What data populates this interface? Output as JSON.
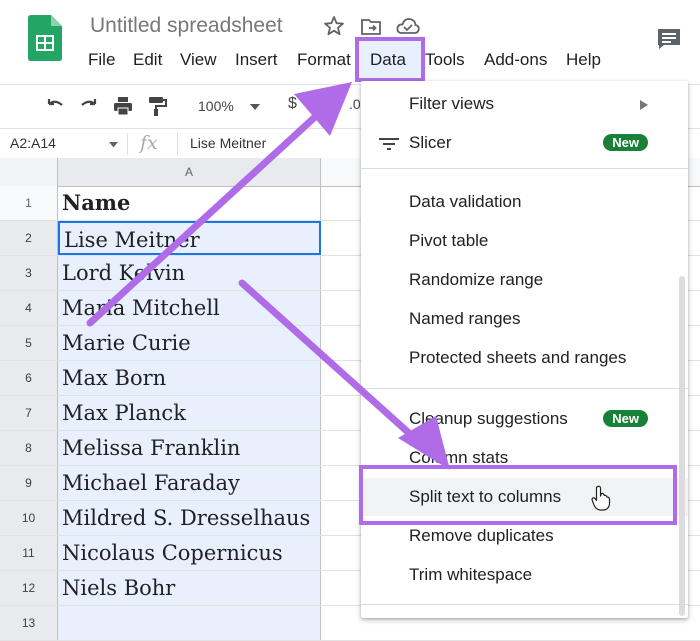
{
  "app": {
    "title": "Untitled spreadsheet",
    "logo_icon": "sheets-logo-icon"
  },
  "menu": {
    "file": "File",
    "edit": "Edit",
    "view": "View",
    "insert": "Insert",
    "format": "Format",
    "data": "Data",
    "tools": "Tools",
    "addons": "Add-ons",
    "help": "Help"
  },
  "toolbar": {
    "zoom": "100%",
    "currency": "$",
    "decimal": ".0"
  },
  "formula_bar": {
    "name_box": "A2:A14",
    "fx": "fx",
    "value": "Lise Meitner"
  },
  "grid": {
    "column_a": "A",
    "rows": [
      {
        "num": "1",
        "value": "Name"
      },
      {
        "num": "2",
        "value": "Lise Meitner"
      },
      {
        "num": "3",
        "value": "Lord Kelvin"
      },
      {
        "num": "4",
        "value": "Maria Mitchell"
      },
      {
        "num": "5",
        "value": "Marie Curie"
      },
      {
        "num": "6",
        "value": "Max Born"
      },
      {
        "num": "7",
        "value": "Max Planck"
      },
      {
        "num": "8",
        "value": "Melissa Franklin"
      },
      {
        "num": "9",
        "value": "Michael Faraday"
      },
      {
        "num": "10",
        "value": "Mildred S. Dresselhaus"
      },
      {
        "num": "11",
        "value": "Nicolaus Copernicus"
      },
      {
        "num": "12",
        "value": "Niels Bohr"
      },
      {
        "num": "13",
        "value": ""
      }
    ]
  },
  "data_menu": {
    "filter_views": "Filter views",
    "slicer": "Slicer",
    "new_badge_1": "New",
    "data_validation": "Data validation",
    "pivot_table": "Pivot table",
    "randomize_range": "Randomize range",
    "named_ranges": "Named ranges",
    "protected_sheets": "Protected sheets and ranges",
    "cleanup_suggestions": "Cleanup suggestions",
    "new_badge_2": "New",
    "column_stats": "Column stats",
    "split_text": "Split text to columns",
    "remove_duplicates": "Remove duplicates",
    "trim_whitespace": "Trim whitespace"
  },
  "colors": {
    "highlight": "#b06ce8",
    "selection": "#e8f0fe",
    "badge": "#188038",
    "sheets_green": "#23a566"
  }
}
